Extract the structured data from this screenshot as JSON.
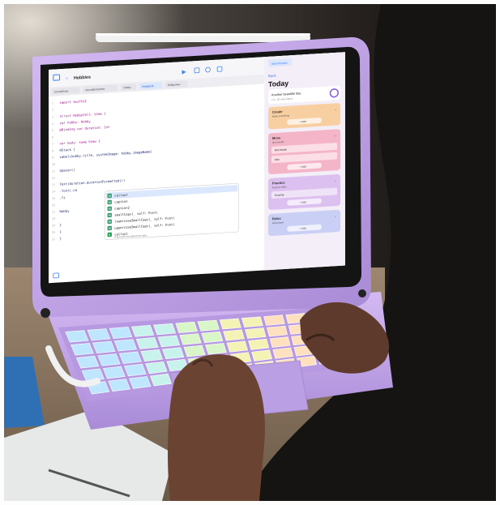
{
  "app": {
    "project": "Hobbies",
    "tabs": [
      {
        "label": "JournalEntry"
      },
      {
        "label": "JournalEntryView"
      },
      {
        "label": "Hobby"
      },
      {
        "label": "HobbyCell",
        "active": true
      },
      {
        "label": "HobbyView"
      }
    ],
    "code_lines": [
      "import SwiftUI",
      "",
      "struct HobbyCell: View {",
      "    var hobby: Hobby",
      "    @Binding var duration: Int",
      "",
      "    var body: some View {",
      "        HStack {",
      "            Label(hobby.title, systemImage: hobby.imageName)",
      "",
      "            Spacer()",
      "",
      "            Text(duration.durationFormatted())",
      "                .font(.ca",
      "            .fi",
      "",
      "        Hobby",
      "",
      "        }",
      "    }",
      "}"
    ],
    "autocomplete": [
      {
        "badge": "M",
        "text": "callout",
        "selected": true
      },
      {
        "badge": "M",
        "text": "caption"
      },
      {
        "badge": "M",
        "text": "caption2"
      },
      {
        "badge": "M",
        "text": "smallCaps(_ self: Font)"
      },
      {
        "badge": "M",
        "text": "lowercaseSmallCaps(_ self: Font)"
      },
      {
        "badge": "M",
        "text": "uppercaseSmallCaps(_ self: Font)"
      },
      {
        "badge": "S",
        "text": "callout"
      }
    ],
    "autocomplete_hint": "A font with the callout text style."
  },
  "preview": {
    "button": "Add Preview",
    "back": "Back",
    "title": "Today",
    "subtitle": "Another beautiful day",
    "sub2": "7 hr, 30 mins listed",
    "cards": [
      {
        "title": "Create",
        "sub": "Make something",
        "add": "+ Add",
        "color": "#f8cfa0"
      },
      {
        "title": "Move",
        "sub": "Get outside",
        "row1": "Bird Watch",
        "row2": "Hike",
        "add": "+ Add",
        "color": "#f5b5c8"
      },
      {
        "title": "Practice",
        "sub": "Improve skills",
        "row1": "Drawing",
        "add": "+ Add",
        "color": "#dcc0f0"
      },
      {
        "title": "Relax",
        "sub": "Wind down",
        "add": "+ Add",
        "color": "#c9cff5"
      }
    ]
  },
  "colors": {
    "device": "#c4a5e8",
    "device_dark": "#9d7bc9",
    "keyboard": "#c6a9ea",
    "accent": "#3b82f6"
  }
}
